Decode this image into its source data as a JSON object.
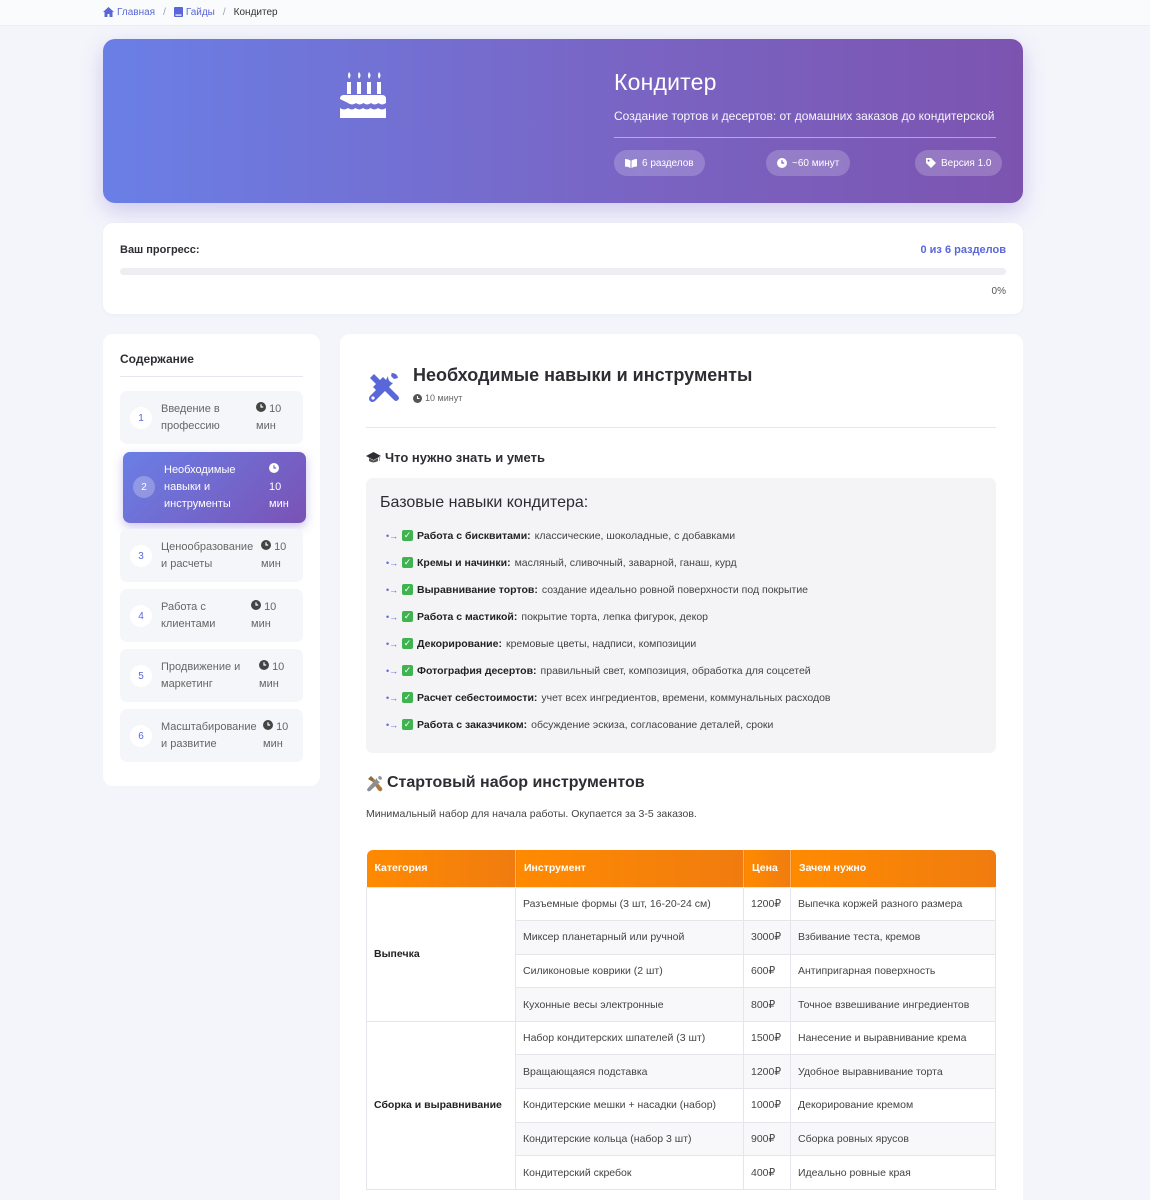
{
  "breadcrumb": {
    "home": "Главная",
    "guides": "Гайды",
    "current": "Кондитер",
    "sep": "/"
  },
  "hero": {
    "title": "Кондитер",
    "subtitle": "Создание тортов и десертов: от домашних заказов до кондитерской",
    "chips": {
      "sections": "6 разделов",
      "time": "~60 минут",
      "version": "Версия 1.0"
    }
  },
  "progress": {
    "label": "Ваш прогресс:",
    "count": "0 из 6 разделов",
    "percent_label": "0%",
    "value": 0
  },
  "toc": {
    "title": "Содержание",
    "items": [
      {
        "num": "1",
        "label": "Введение в профессию",
        "duration": "10 мин"
      },
      {
        "num": "2",
        "label": "Необходимые навыки и инструменты",
        "duration": "10 мин",
        "active": true
      },
      {
        "num": "3",
        "label": "Ценообразование и расчеты",
        "duration": "10 мин"
      },
      {
        "num": "4",
        "label": "Работа с клиентами",
        "duration": "10 мин"
      },
      {
        "num": "5",
        "label": "Продвижение и маркетинг",
        "duration": "10 мин"
      },
      {
        "num": "6",
        "label": "Масштабирование и развитие",
        "duration": "10 мин"
      }
    ]
  },
  "section": {
    "title": "Необходимые навыки и инструменты",
    "time": "10 минут",
    "h3": "Что нужно знать и уметь",
    "box_title": "Базовые навыки кондитера:",
    "skills": [
      {
        "name": "Работа с бисквитами:",
        "desc": "классические, шоколадные, с добавками"
      },
      {
        "name": "Кремы и начинки:",
        "desc": "масляный, сливочный, заварной, ганаш, курд"
      },
      {
        "name": "Выравнивание тортов:",
        "desc": "создание идеально ровной поверхности под покрытие"
      },
      {
        "name": "Работа с мастикой:",
        "desc": "покрытие торта, лепка фигурок, декор"
      },
      {
        "name": "Декорирование:",
        "desc": "кремовые цветы, надписи, композиции"
      },
      {
        "name": "Фотография десертов:",
        "desc": "правильный свет, композиция, обработка для соцсетей"
      },
      {
        "name": "Расчет себестоимости:",
        "desc": "учет всех ингредиентов, времени, коммунальных расходов"
      },
      {
        "name": "Работа с заказчиком:",
        "desc": "обсуждение эскиза, согласование деталей, сроки"
      }
    ],
    "h2": "Стартовый набор инструментов",
    "intro": "Минимальный набор для начала работы. Окупается за 3-5 заказов.",
    "table": {
      "headers": [
        "Категория",
        "Инструмент",
        "Цена",
        "Зачем нужно"
      ],
      "groups": [
        {
          "category": "Выпечка",
          "rows": [
            {
              "tool": "Разъемные формы (3 шт, 16-20-24 см)",
              "price": "1200₽",
              "why": "Выпечка коржей разного размера"
            },
            {
              "tool": "Миксер планетарный или ручной",
              "price": "3000₽",
              "why": "Взбивание теста, кремов"
            },
            {
              "tool": "Силиконовые коврики (2 шт)",
              "price": "600₽",
              "why": "Антипригарная поверхность"
            },
            {
              "tool": "Кухонные весы электронные",
              "price": "800₽",
              "why": "Точное взвешивание ингредиентов"
            }
          ]
        },
        {
          "category": "Сборка и выравнивание",
          "rows": [
            {
              "tool": "Набор кондитерских шпателей (3 шт)",
              "price": "1500₽",
              "why": "Нанесение и выравнивание крема"
            },
            {
              "tool": "Вращающаяся подставка",
              "price": "1200₽",
              "why": "Удобное выравнивание торта"
            },
            {
              "tool": "Кондитерские мешки + насадки (набор)",
              "price": "1000₽",
              "why": "Декорирование кремом"
            },
            {
              "tool": "Кондитерские кольца (набор 3 шт)",
              "price": "900₽",
              "why": "Сборка ровных ярусов"
            },
            {
              "tool": "Кондитерский скребок",
              "price": "400₽",
              "why": "Идеально ровные края"
            }
          ]
        }
      ]
    }
  },
  "colors": {
    "accent": "#5a67d8",
    "hero_start": "#6a7fe6",
    "hero_end": "#7c54b0",
    "table_header": "#ff8a00",
    "check": "#3fb34f"
  }
}
